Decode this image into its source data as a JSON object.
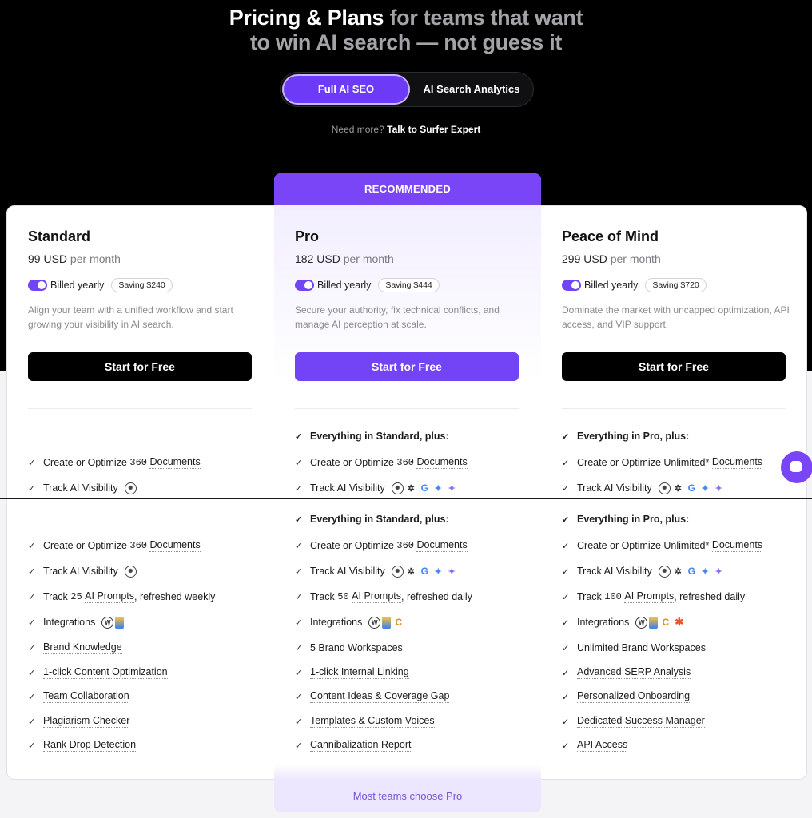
{
  "header": {
    "title_white": "Pricing & Plans",
    "title_gray_1": "for teams that want",
    "title_gray_2": "to win AI search — not guess it",
    "switch": {
      "active": "Full AI SEO",
      "inactive": "AI Search Analytics"
    },
    "need_more": "Need more?",
    "need_more_link": "Talk to Surfer Expert"
  },
  "recommended_label": "RECOMMENDED",
  "pro_footer": "Most teams choose Pro",
  "plans": [
    {
      "name": "Standard",
      "price": "99 USD",
      "price_unit": "per month",
      "billing": "Billed yearly",
      "saving": "Saving $240",
      "description": "Align your team with a unified workflow and start growing your visibility in AI search.",
      "cta": "Start for Free",
      "upper": {
        "documents": {
          "pre": "Create or Optimize",
          "num": "360",
          "link": "Documents"
        },
        "visibility": "Track AI Visibility"
      },
      "features": {
        "documents": {
          "pre": "Create or Optimize",
          "num": "360",
          "link": "Documents"
        },
        "visibility": "Track AI Visibility",
        "prompts": {
          "pre": "Track",
          "num": "25",
          "link": "AI Prompts",
          "post": ", refreshed weekly"
        },
        "integrations": "Integrations",
        "list": [
          "Brand Knowledge",
          "1-click Content Optimization",
          "Team Collaboration",
          "Plagiarism Checker",
          "Rank Drop Detection"
        ]
      }
    },
    {
      "name": "Pro",
      "price": "182 USD",
      "price_unit": "per month",
      "billing": "Billed yearly",
      "saving": "Saving $444",
      "description": "Secure your authority, fix technical conflicts, and manage AI perception at scale.",
      "cta": "Start for Free",
      "upper": {
        "everything": "Everything in Standard, plus:",
        "documents": {
          "pre": "Create or Optimize",
          "num": "360",
          "link": "Documents"
        },
        "visibility": "Track AI Visibility"
      },
      "features": {
        "everything": "Everything in Standard, plus:",
        "documents": {
          "pre": "Create or Optimize",
          "num": "360",
          "link": "Documents"
        },
        "visibility": "Track AI Visibility",
        "prompts": {
          "pre": "Track",
          "num": "50",
          "link": "AI Prompts",
          "post": ", refreshed daily"
        },
        "integrations": "Integrations",
        "workspaces": "5 Brand Workspaces",
        "list": [
          "1-click Internal Linking",
          "Content Ideas & Coverage Gap",
          "Templates & Custom Voices",
          "Cannibalization Report"
        ]
      }
    },
    {
      "name": "Peace of Mind",
      "price": "299 USD",
      "price_unit": "per month",
      "billing": "Billed yearly",
      "saving": "Saving $720",
      "description": "Dominate the market with uncapped optimization, API access, and VIP support.",
      "cta": "Start for Free",
      "upper": {
        "everything": "Everything in Pro, plus:",
        "documents": {
          "pre": "Create or Optimize Unlimited*",
          "link": "Documents"
        },
        "visibility": "Track AI Visibility"
      },
      "features": {
        "everything": "Everything in Pro, plus:",
        "documents": {
          "pre": "Create or Optimize Unlimited*",
          "link": "Documents"
        },
        "visibility": "Track AI Visibility",
        "prompts": {
          "pre": "Track",
          "num": "100",
          "link": "AI Prompts",
          "post": ", refreshed daily"
        },
        "integrations": "Integrations",
        "workspaces": "Unlimited Brand Workspaces",
        "list": [
          "Advanced SERP Analysis",
          "Personalized Onboarding",
          "Dedicated Success Manager",
          "API Access"
        ]
      }
    }
  ],
  "icons": {
    "ai_platforms": [
      "chatgpt-icon",
      "perplexity-icon",
      "google-icon",
      "gemini-icon",
      "ai-sparkle-icon"
    ],
    "integrations": [
      "wordpress-icon",
      "google-docs-icon",
      "contentful-icon",
      "asterisk-app-icon"
    ]
  },
  "colors": {
    "accent": "#7244f6",
    "hero_bg": "#000000",
    "page_bg": "#f4f4f6"
  }
}
